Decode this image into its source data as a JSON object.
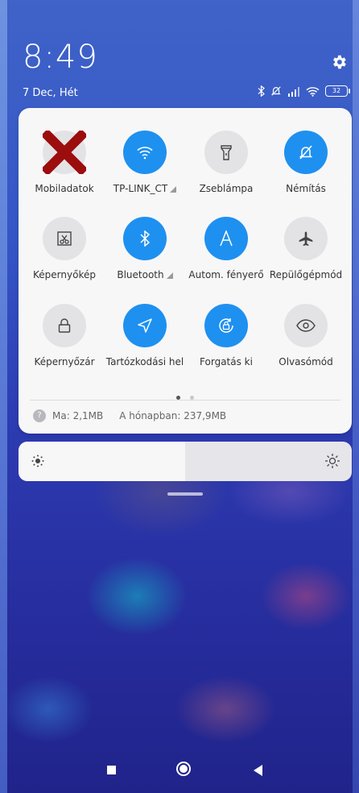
{
  "status": {
    "time": "8:49",
    "date": "7 Dec, Hét",
    "battery": "32",
    "icons": [
      "bluetooth-icon",
      "mute-icon",
      "signal-icon",
      "wifi-icon",
      "battery-icon"
    ]
  },
  "tiles": [
    {
      "label": "Mobiladatok",
      "icon": "mobile-data-icon",
      "active": false
    },
    {
      "label": "TP-LINK_CT",
      "icon": "wifi-icon",
      "active": true
    },
    {
      "label": "Zseblámpa",
      "icon": "flashlight-icon",
      "active": false
    },
    {
      "label": "Némítás",
      "icon": "mute-bell-icon",
      "active": true
    },
    {
      "label": "Képernyőkép",
      "icon": "screenshot-icon",
      "active": false
    },
    {
      "label": "Bluetooth",
      "icon": "bluetooth-icon",
      "active": true
    },
    {
      "label": "Autom. fényerő",
      "icon": "auto-brightness-icon",
      "active": true
    },
    {
      "label": "Repülőgépmód",
      "icon": "airplane-icon",
      "active": false
    },
    {
      "label": "Képernyőzár",
      "icon": "lock-icon",
      "active": false
    },
    {
      "label": "Tartózkodási hel",
      "icon": "location-icon",
      "active": true
    },
    {
      "label": "Forgatás ki",
      "icon": "rotation-lock-icon",
      "active": true
    },
    {
      "label": "Olvasómód",
      "icon": "reading-mode-icon",
      "active": false
    }
  ],
  "data_usage": {
    "today": "Ma: 2,1MB",
    "month": "A hónapban: 237,9MB"
  },
  "page_indicator": {
    "current": 1,
    "total": 2
  },
  "brightness": {
    "level": 0.5
  },
  "colors": {
    "accent": "#1e90f0",
    "tile_off": "#e3e3e6",
    "panel": "#f7f7f8"
  }
}
